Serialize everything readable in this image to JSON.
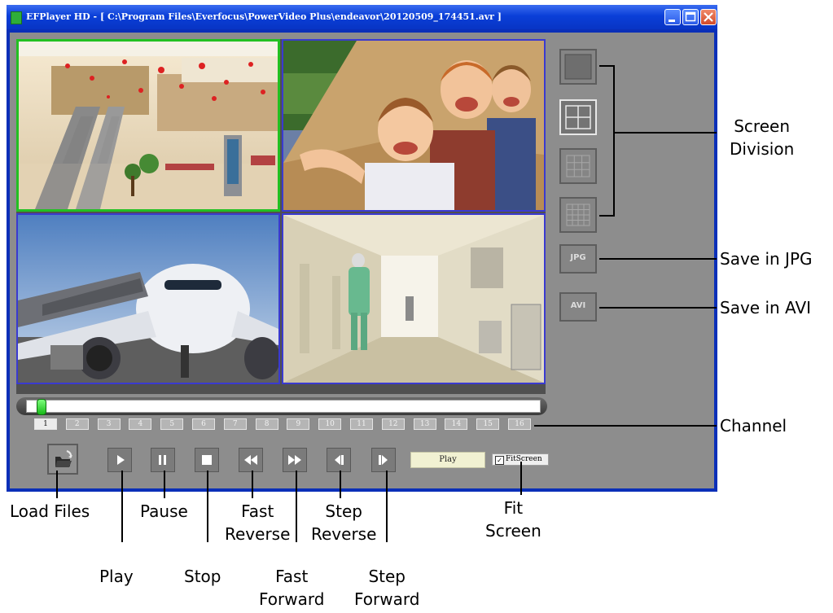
{
  "window": {
    "title": "EFPlayer HD - [ C:\\Program Files\\Everfocus\\PowerVideo Plus\\endeavor\\20120509_174451.avr ]",
    "controls": [
      "minimize",
      "maximize",
      "close"
    ]
  },
  "video": {
    "layout": "2x2",
    "panes": [
      {
        "scene": "shopping-mall-escalator",
        "selected": true
      },
      {
        "scene": "three-children-smiling",
        "selected": false
      },
      {
        "scene": "airplane-at-jet-bridge",
        "selected": false
      },
      {
        "scene": "hospital-corridor",
        "selected": false
      }
    ]
  },
  "playback": {
    "position": 0.02,
    "status": "Play",
    "fit_screen_label": "FitScreen",
    "fit_screen_checked": true
  },
  "channels": [
    "1",
    "2",
    "3",
    "4",
    "5",
    "6",
    "7",
    "8",
    "9",
    "10",
    "11",
    "12",
    "13",
    "14",
    "15",
    "16"
  ],
  "active_channel": "1",
  "side_buttons": {
    "jpg_label": "JPG",
    "avi_label": "AVI"
  },
  "controls": [
    {
      "name": "load-files",
      "icon": "folder-icon"
    },
    {
      "name": "play",
      "icon": "play-icon"
    },
    {
      "name": "pause",
      "icon": "pause-icon"
    },
    {
      "name": "stop",
      "icon": "stop-icon"
    },
    {
      "name": "fast-reverse",
      "icon": "fast-reverse-icon"
    },
    {
      "name": "fast-forward",
      "icon": "fast-forward-icon"
    },
    {
      "name": "step-reverse",
      "icon": "step-reverse-icon"
    },
    {
      "name": "step-forward",
      "icon": "step-forward-icon"
    }
  ],
  "callouts": {
    "screen_division": [
      "Screen",
      "Division"
    ],
    "save_jpg": "Save in JPG",
    "save_avi": "Save in AVI",
    "channel": "Channel",
    "load_files": "Load Files",
    "pause": "Pause",
    "fast_reverse": [
      "Fast",
      "Reverse"
    ],
    "step_reverse": [
      "Step",
      "Reverse"
    ],
    "fit_screen": [
      "Fit",
      "Screen"
    ],
    "play": "Play",
    "stop": "Stop",
    "fast_forward": [
      "Fast",
      "Forward"
    ],
    "step_forward": [
      "Step",
      "Forward"
    ]
  },
  "colors": {
    "window_frame": "#0a2fb8",
    "client_bg": "#8d8d8d",
    "selected_pane": "#22c022",
    "pane_border": "#3a3ad0"
  }
}
